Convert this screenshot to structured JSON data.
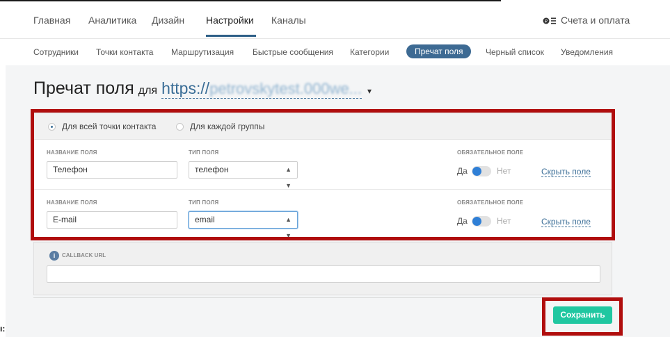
{
  "main_nav": {
    "items": [
      "Главная",
      "Аналитика",
      "Дизайн",
      "Настройки",
      "Каналы"
    ],
    "active": "Настройки",
    "billing_label": "Счета и оплата",
    "billing_icon": "billing-icon"
  },
  "sub_nav": {
    "items": [
      "Сотрудники",
      "Точки контакта",
      "Маршрутизация",
      "Быстрые сообщения",
      "Категории",
      "Пречат поля",
      "Черный список",
      "Уведомления"
    ],
    "active": "Пречат поля"
  },
  "page": {
    "title": "Пречат поля",
    "title_for": "для",
    "url_prefix": "https://",
    "url_blurred": "petrovskytest.000we...",
    "caret": "▾"
  },
  "scope": {
    "option_all": "Для всей точки контакта",
    "option_group": "Для каждой группы",
    "selected": "Для всей точки контакта"
  },
  "fields": {
    "header_name": "НАЗВАНИЕ ПОЛЯ",
    "header_type": "ТИП ПОЛЯ",
    "header_required": "ОБЯЗАТЕЛЬНОЕ ПОЛЕ",
    "yes": "Да",
    "no": "Нет",
    "hide_label": "Скрыть поле",
    "rows": [
      {
        "name": "Телефон",
        "type": "телефон",
        "required": false
      },
      {
        "name": "E-mail",
        "type": "email",
        "required": false
      }
    ]
  },
  "callback": {
    "label": "CALLBACK URL",
    "value": ""
  },
  "actions": {
    "save_label": "Сохранить"
  },
  "colors": {
    "accent": "#3d6a93",
    "save": "#20c7a1",
    "highlight": "#b00d0d",
    "toggle": "#2f7fd6"
  },
  "stray_mark": "ı:"
}
